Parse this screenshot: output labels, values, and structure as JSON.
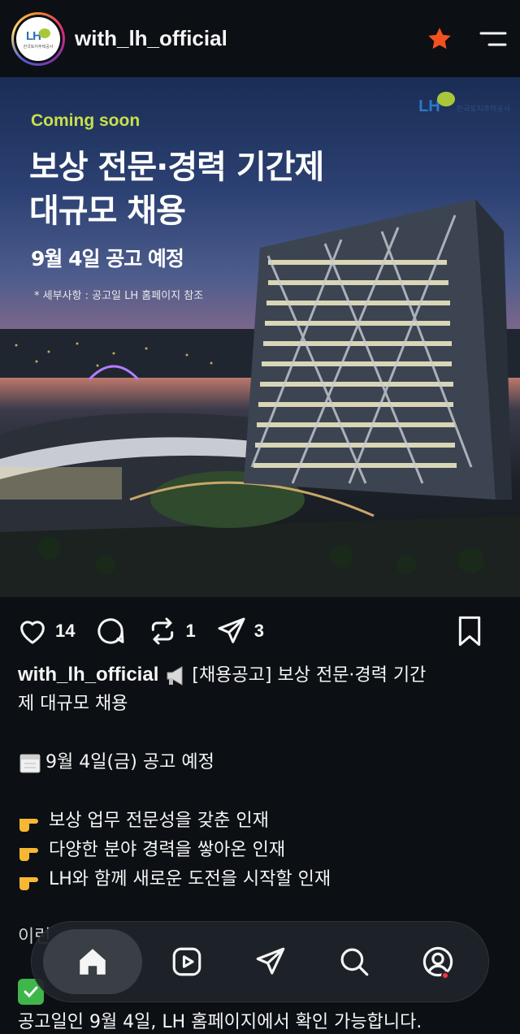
{
  "header": {
    "username": "with_lh_official",
    "avatar_logo_text": "LH",
    "avatar_logo_sub": "한국토지주택공사",
    "favorite_icon": "star-icon",
    "menu_icon": "hamburger-menu-icon",
    "favorite_color": "#f4511e"
  },
  "post_image": {
    "coming_soon": "Coming soon",
    "headline_line1": "보상 전문·경력 기간제",
    "headline_line2": "대규모 채용",
    "subline": "9월 4일 공고 예정",
    "footnote": "* 세부사항 : 공고일 LH 홈페이지 참조",
    "logo_letters": "LH",
    "logo_sub": "한국토지주택공사",
    "accent_color": "#c8e04a"
  },
  "actions": {
    "likes": "14",
    "reposts": "1",
    "shares": "3"
  },
  "caption": {
    "username": "with_lh_official",
    "line1_rest": "[채용공고] 보상 전문·경력 기간",
    "line2": "제 대규모 채용",
    "line3": "9월 4일(금) 공고 예정",
    "point1": "보상 업무 전문성을 갖춘 인재",
    "point2": "다양한 분야 경력을 쌓아온 인재",
    "point3": "LH와 함께 새로운 도전을 시작할 인재",
    "partial": "이런",
    "last_line": "공고일인 9월 4일, LH 홈페이지에서 확인 가능합니다."
  },
  "nav": {
    "items": [
      "home",
      "reels",
      "direct",
      "search",
      "profile"
    ],
    "active": "home"
  }
}
